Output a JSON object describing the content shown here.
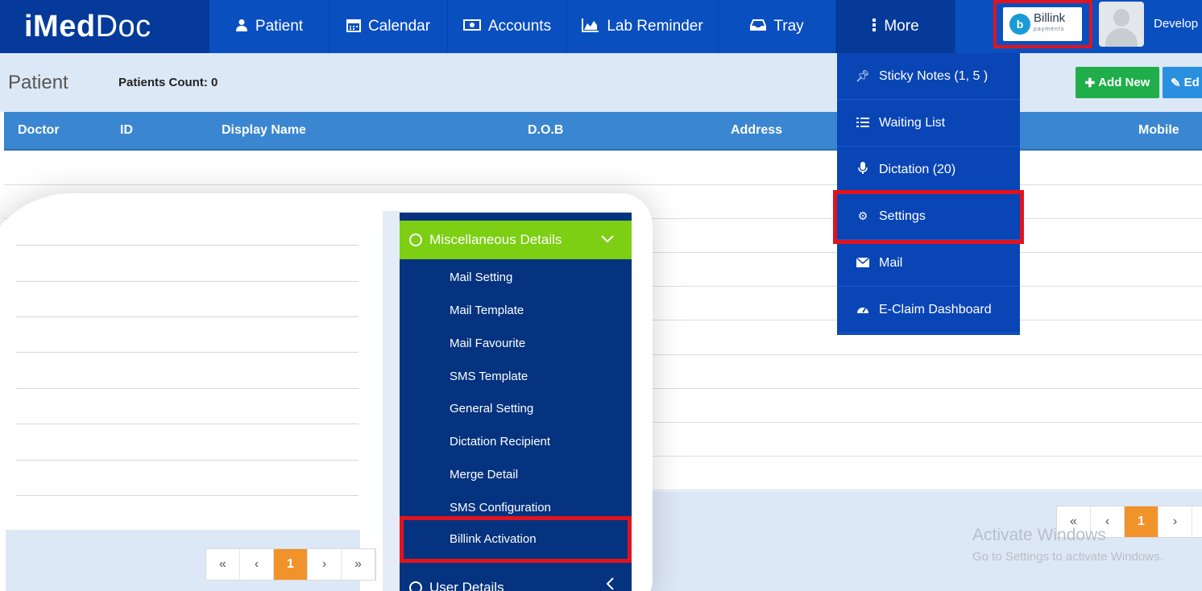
{
  "app": {
    "logo_bold": "iMed",
    "logo_light": "Doc"
  },
  "nav": {
    "items": [
      {
        "label": "Patient",
        "icon": "user-icon"
      },
      {
        "label": "Calendar",
        "icon": "calendar-icon"
      },
      {
        "label": "Accounts",
        "icon": "money-icon"
      },
      {
        "label": "Lab Reminder",
        "icon": "area-chart-icon"
      },
      {
        "label": "Tray",
        "icon": "inbox-icon"
      },
      {
        "label": "More",
        "icon": "vertical-ellipsis-icon"
      }
    ],
    "billink": {
      "brand": "Billink",
      "sub": "payments",
      "letter": "b"
    },
    "user_name": "Develop"
  },
  "header": {
    "title": "Patient",
    "count_label": "Patients Count: 0",
    "add_new": "Add New",
    "edit": "Ed"
  },
  "table": {
    "columns": [
      "Doctor",
      "ID",
      "Display Name",
      "D.O.B",
      "Address",
      "Mobile"
    ]
  },
  "more_menu": {
    "items": [
      {
        "label": "Sticky Notes (1, 5 )",
        "icon": "pin-icon"
      },
      {
        "label": "Waiting List",
        "icon": "list-icon"
      },
      {
        "label": "Dictation (20)",
        "icon": "microphone-icon"
      },
      {
        "label": "Settings",
        "icon": "cogs-icon"
      },
      {
        "label": "Mail",
        "icon": "envelope-icon"
      },
      {
        "label": "E-Claim Dashboard",
        "icon": "dashboard-icon"
      }
    ]
  },
  "pager": {
    "first": "«",
    "prev": "‹",
    "current": "1",
    "next": "›",
    "last": "»"
  },
  "settings_menu": {
    "section": "Miscellaneous Details",
    "items": [
      "Mail Setting",
      "Mail Template",
      "Mail Favourite",
      "SMS Template",
      "General Setting",
      "Dictation Recipient",
      "Merge Detail",
      "SMS Configuration",
      "Billink Activation"
    ],
    "next_section": "User Details"
  },
  "watermark": {
    "line1": "Activate Windows",
    "line2": "Go to Settings to activate Windows."
  },
  "colors": {
    "nav_bg": "#0a4fc0",
    "highlight_red": "#e0141e",
    "add_green": "#1fae4a",
    "pager_active": "#f2922a",
    "section_green": "#7ccf12"
  }
}
